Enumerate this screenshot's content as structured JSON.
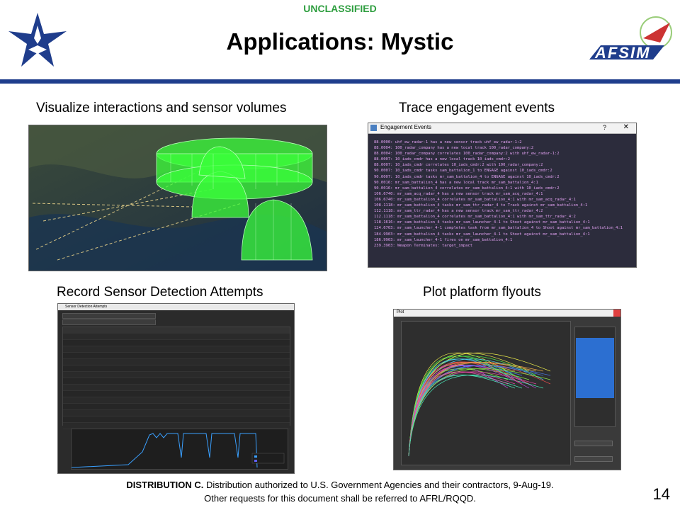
{
  "header": {
    "classification": "UNCLASSIFIED",
    "title": "Applications: Mystic"
  },
  "logos": {
    "right_logo_text": "AFSIM"
  },
  "panels": {
    "top_left_caption": "Visualize interactions and sensor volumes",
    "top_right_caption": "Trace engagement events",
    "bottom_left_caption": "Record Sensor Detection Attempts",
    "bottom_right_caption": "Plot platform flyouts"
  },
  "engagement_window": {
    "title": "Engagement Events",
    "help": "?",
    "close": "✕",
    "lines": [
      "88.0000: uhf_ew_radar-1 has a new sensor track uhf_ew_radar-1:2",
      "88.0004: 100_radar_company has a new local track 100_radar_company:2",
      "88.0004: 100_radar_company correlates 100_radar_company:2 with uhf_ew_radar-1:2",
      "88.0007: 10_iads_cmdr has a new local track 10_iads_cmdr:2",
      "88.0007: 10_iads_cmdr correlates 10_iads_cmdr:2 with 100_radar_company:2",
      "90.0007: 10_iads_cmdr tasks sam_battalion_1 to ENGAGE against 10_iads_cmdr:2",
      "90.0007: 10_iads_cmdr tasks mr_sam_battalion_4 to ENGAGE against 10_iads_cmdr:2",
      "90.0016: mr_sam_battalion_4 has a new local track mr_sam_battalion_4:1",
      "90.0016: mr_sam_battalion_4 correlates mr_sam_battalion_4:1 with 10_iads_cmdr:2",
      "106.6740: mr_sam_acq_radar_4 has a new sensor track mr_sam_acq_radar_4:1",
      "106.6740: mr_sam_battalion_4 correlates mr_sam_battalion_4:1 with mr_sam_acq_radar_4:1",
      "108.1118: mr_sam_battalion_4 tasks mr_sam_ttr_radar_4 to Track against mr_sam_battalion_4:1",
      "112.1118: mr_sam_ttr_radar_4 has a new sensor track mr_sam_ttr_radar_4:2",
      "112.1118: mr_sam_battalion_4 correlates mr_sam_battalion_4:1 with mr_sam_ttr_radar_4:2",
      "118.1616: mr_sam_battalion_4 tasks mr_sam_launcher_4-1 to Shoot against mr_sam_battalion_4:1",
      "124.6703: mr_sam_launcher_4-1 completes task from mr_sam_battalion_4 to Shoot against mr_sam_battalion_4:1",
      "184.9903: mr_sam_battalion_4 tasks mr_sam_launcher_4-1 to Shoot against mr_sam_battalion_4:1",
      "186.9903: mr_sam_launcher_4-1 fires on mr_sam_battalion_4:1",
      "239.3903: Weapon Terminates: target_impact"
    ]
  },
  "plot_window": {
    "title": "Plot"
  },
  "detection_window": {
    "title": "Sensor Detection Attempts"
  },
  "colors": {
    "rule_blue": "#1f3d8c",
    "classification_green": "#2e9e3f",
    "volume_green": "#3bff3b",
    "console_bg": "#2c2c3c"
  },
  "footer": {
    "distribution_label": "DISTRIBUTION C.",
    "distribution_text": " Distribution authorized to U.S. Government Agencies and their contractors, 9-Aug-19.",
    "line2": "Other requests for this document shall be referred to AFRL/RQQD."
  },
  "page_number": "14"
}
